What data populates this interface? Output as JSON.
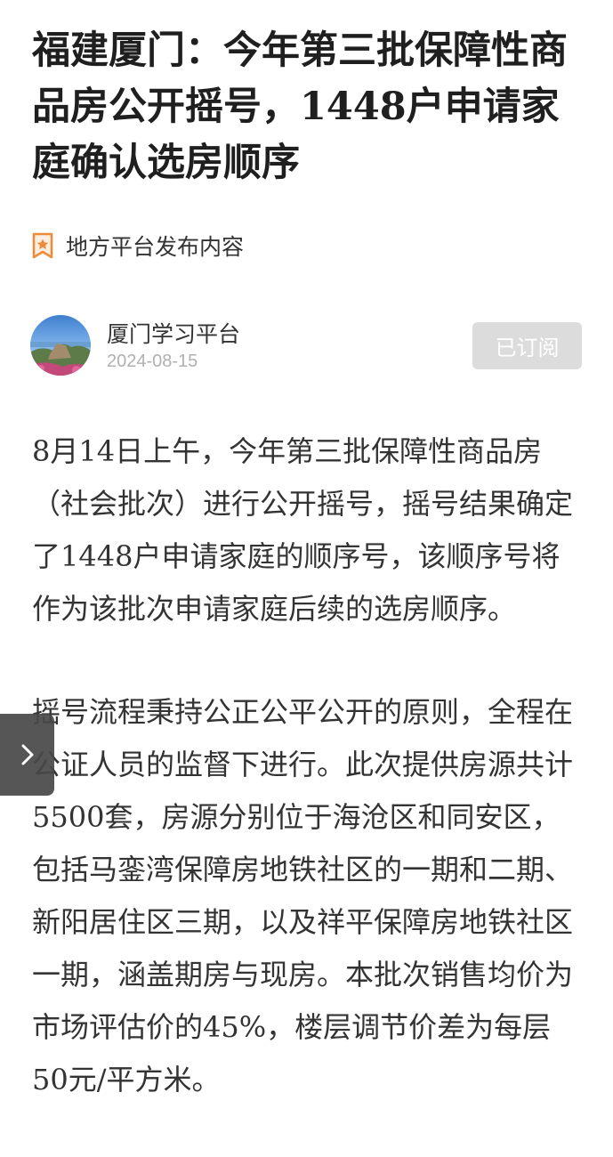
{
  "article": {
    "title": "福建厦门：今年第三批保障性商品房公开摇号，1448户申请家庭确认选房顺序",
    "source_label": "地方平台发布内容",
    "author": {
      "name": "厦门学习平台",
      "date": "2024-08-15",
      "subscribe_label": "已订阅"
    },
    "paragraphs": [
      "8月14日上午，今年第三批保障性商品房（社会批次）进行公开摇号，摇号结果确定了1448户申请家庭的顺序号，该顺序号将作为该批次申请家庭后续的选房顺序。",
      "摇号流程秉持公正公平公开的原则，全程在公证人员的监督下进行。此次提供房源共计5500套，房源分别位于海沧区和同安区，包括马銮湾保障房地铁社区的一期和二期、新阳居住区三期，以及祥平保障房地铁社区一期，涵盖期房与现房。本批次销售均价为市场评估价的45%，楼层调节价差为每层50元/平方米。"
    ]
  },
  "icons": {
    "source": "star-badge-icon",
    "side_tab": "chevron-right-icon"
  },
  "colors": {
    "source_icon": "#f08a38",
    "subscribe_button_bg": "#dcdcdc",
    "side_tab_bg": "#484848"
  }
}
